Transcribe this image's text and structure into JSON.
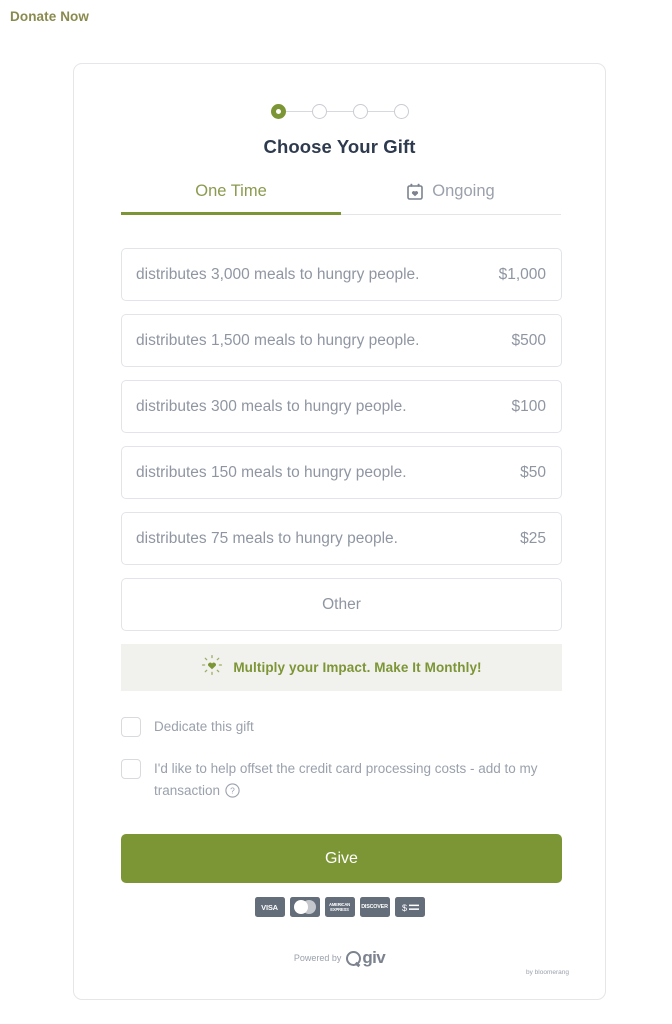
{
  "page": {
    "header_title": "Donate Now"
  },
  "stepper": {
    "total_steps": 4,
    "current_step": 1
  },
  "form": {
    "title": "Choose Your Gift",
    "tabs": [
      {
        "label": "One Time",
        "icon": null,
        "active": true
      },
      {
        "label": "Ongoing",
        "icon": "calendar-heart-icon",
        "active": false
      }
    ],
    "amounts": [
      {
        "description": "distributes 3,000 meals to hungry people.",
        "value": "$1,000"
      },
      {
        "description": "distributes 1,500 meals to hungry people.",
        "value": "$500"
      },
      {
        "description": "distributes 300 meals to hungry people.",
        "value": "$100"
      },
      {
        "description": "distributes 150 meals to hungry people.",
        "value": "$50"
      },
      {
        "description": "distributes 75 meals to hungry people.",
        "value": "$25"
      }
    ],
    "other_label": "Other",
    "monthly_banner": {
      "icon": "sparkle-heart-icon",
      "text": "Multiply your Impact. Make It Monthly!"
    },
    "checkboxes": [
      {
        "label": "Dedicate this gift",
        "checked": false,
        "has_help": false
      },
      {
        "label": "I'd like to help offset the credit card processing costs - add to my transaction",
        "checked": false,
        "has_help": true
      }
    ],
    "submit_label": "Give"
  },
  "payments": [
    {
      "name": "visa-badge",
      "label": "VISA"
    },
    {
      "name": "mastercard-badge",
      "label": ""
    },
    {
      "name": "amex-badge",
      "label": "AMERICAN EXPRESS"
    },
    {
      "name": "discover-badge",
      "label": "DISCOVER"
    },
    {
      "name": "check-ach-badge",
      "label": "$"
    }
  ],
  "footer": {
    "powered_by": "Powered by",
    "brand": "giv",
    "sub_brand": "by bloomerang"
  },
  "colors": {
    "brand_green": "#7c9635",
    "header_olive": "#8a8a4e",
    "title_navy": "#2e3a4e",
    "muted_text": "#9aa1ac",
    "border": "#e2e4e9",
    "banner_bg": "#f1f1ee"
  }
}
